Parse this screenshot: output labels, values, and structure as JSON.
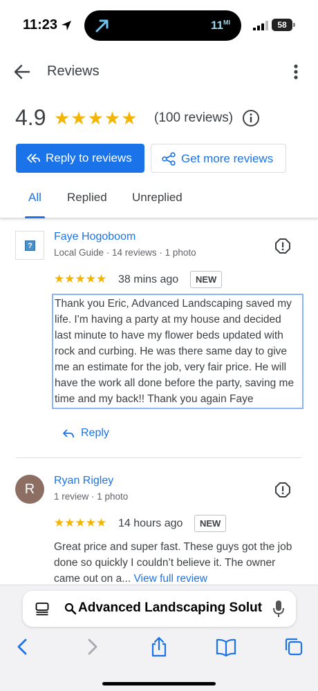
{
  "status_bar": {
    "time": "11:23",
    "island_distance": "11",
    "island_unit": "MI",
    "battery": "58"
  },
  "header": {
    "title": "Reviews"
  },
  "summary": {
    "rating": "4.9",
    "stars": "★★★★★",
    "review_count": "(100 reviews)"
  },
  "actions": {
    "reply_label": "Reply to reviews",
    "get_more_label": "Get more reviews"
  },
  "tabs": [
    {
      "label": "All",
      "active": true
    },
    {
      "label": "Replied",
      "active": false
    },
    {
      "label": "Unreplied",
      "active": false
    }
  ],
  "reviews": [
    {
      "name": "Faye Hogoboom",
      "meta": "Local Guide · 14 reviews · 1 photo",
      "stars": "★★★★★",
      "time": "38 mins ago",
      "badge": "NEW",
      "text": "Thank you Eric, Advanced Landscaping saved my life. I'm having a party at my house and decided last minute to have my flower beds updated with rock and curbing. He was there same day to give me an estimate for the job, very fair price. He will have the work all done before the party, saving me time and my back!! Thank you again Faye",
      "reply_label": "Reply"
    },
    {
      "name": "Ryan Rigley",
      "avatar_letter": "R",
      "meta": "1 review · 1 photo",
      "stars": "★★★★★",
      "time": "14 hours ago",
      "badge": "NEW",
      "text": "Great price and super fast. These guys got the job done so quickly I couldn’t believe it. The owner came out on a...",
      "view_full": "View full review"
    }
  ],
  "browser": {
    "address": "Advanced Landscaping Solut"
  },
  "colors": {
    "accent": "#1a73e8",
    "star": "#f4b400"
  }
}
